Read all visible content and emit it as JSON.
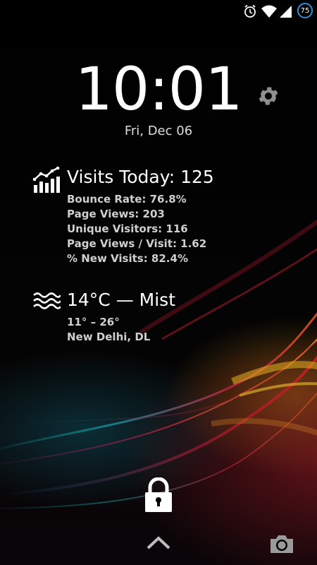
{
  "status_bar": {
    "icons": [
      "alarm-icon",
      "wifi-icon",
      "cell-signal-icon"
    ],
    "battery_level": "75",
    "battery_color": "#2f8fd6"
  },
  "lockscreen": {
    "time": "10:01",
    "date": "Fri, Dec 06"
  },
  "analytics_widget": {
    "icon": "analytics-chart-icon",
    "title": "Visits Today: 125",
    "lines": [
      "Bounce Rate: 76.8%",
      "Page Views: 203",
      "Unique Visitors: 116",
      "Page Views / Visit: 1.62",
      "% New Visits: 82.4%"
    ]
  },
  "weather_widget": {
    "icon": "mist-icon",
    "title": "14°C — Mist",
    "lines": [
      "11° – 26°",
      "New Delhi, DL"
    ]
  },
  "bottom": {
    "icons": [
      "lock-icon",
      "chevron-up-icon",
      "camera-icon"
    ]
  },
  "colors": {
    "text_primary": "#ffffff",
    "text_secondary": "#cfcfcf",
    "icon_gray": "#9a9a9a"
  }
}
